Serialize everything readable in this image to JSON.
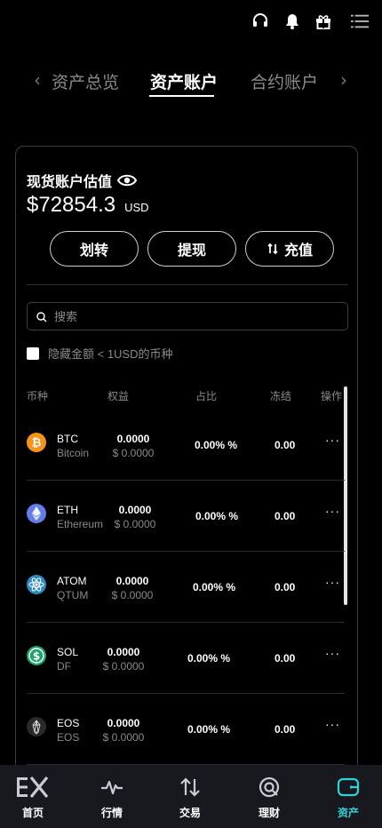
{
  "top_icons": [
    "headset-icon",
    "bell-icon",
    "gift-icon",
    "menu-icon"
  ],
  "tabs": [
    {
      "label": "资产总览"
    },
    {
      "label": "资产账户"
    },
    {
      "label": "合约账户"
    }
  ],
  "card": {
    "title": "现货账户估值",
    "amount": "$72854.3",
    "currency": "USD",
    "buttons": {
      "transfer": "划转",
      "withdraw": "提现",
      "deposit": "充值"
    },
    "search_placeholder": "搜索",
    "hide_small": "隐藏金额 < 1USD的币种"
  },
  "table": {
    "headers": {
      "coin": "币种",
      "equity": "权益",
      "ratio": "占比",
      "frozen": "冻结",
      "action": "操作"
    },
    "rows": [
      {
        "symbol": "BTC",
        "name": "Bitcoin",
        "equity": "0.0000",
        "equity_usd": "$ 0.0000",
        "ratio": "0.00% %",
        "frozen": "0.00",
        "more": "···",
        "icon": "btc-icon",
        "color": "#f7931a"
      },
      {
        "symbol": "ETH",
        "name": "Ethereum",
        "equity": "0.0000",
        "equity_usd": "$ 0.0000",
        "ratio": "0.00% %",
        "frozen": "0.00",
        "more": "···",
        "icon": "eth-icon",
        "color": "#627eea"
      },
      {
        "symbol": "ATOM",
        "name": "QTUM",
        "equity": "0.0000",
        "equity_usd": "$ 0.0000",
        "ratio": "0.00% %",
        "frozen": "0.00",
        "more": "···",
        "icon": "atom-icon",
        "color": "#2e8bc0"
      },
      {
        "symbol": "SOL",
        "name": "DF",
        "equity": "0.0000",
        "equity_usd": "$ 0.0000",
        "ratio": "0.00% %",
        "frozen": "0.00",
        "more": "···",
        "icon": "dollar-coin-icon",
        "color": "#1fa36a"
      },
      {
        "symbol": "EOS",
        "name": "EOS",
        "equity": "0.0000",
        "equity_usd": "$ 0.0000",
        "ratio": "0.00% %",
        "frozen": "0.00",
        "more": "···",
        "icon": "eos-icon",
        "color": "#2a2a2a"
      }
    ]
  },
  "bottom_nav": [
    {
      "label": "首页",
      "icon": "ex-logo-icon"
    },
    {
      "label": "行情",
      "icon": "pulse-icon"
    },
    {
      "label": "交易",
      "icon": "swap-icon"
    },
    {
      "label": "理财",
      "icon": "finance-icon"
    },
    {
      "label": "资产",
      "icon": "wallet-icon"
    }
  ],
  "colors": {
    "accent": "#2fd1d8",
    "background": "#000000",
    "nav_background": "#17191e"
  }
}
